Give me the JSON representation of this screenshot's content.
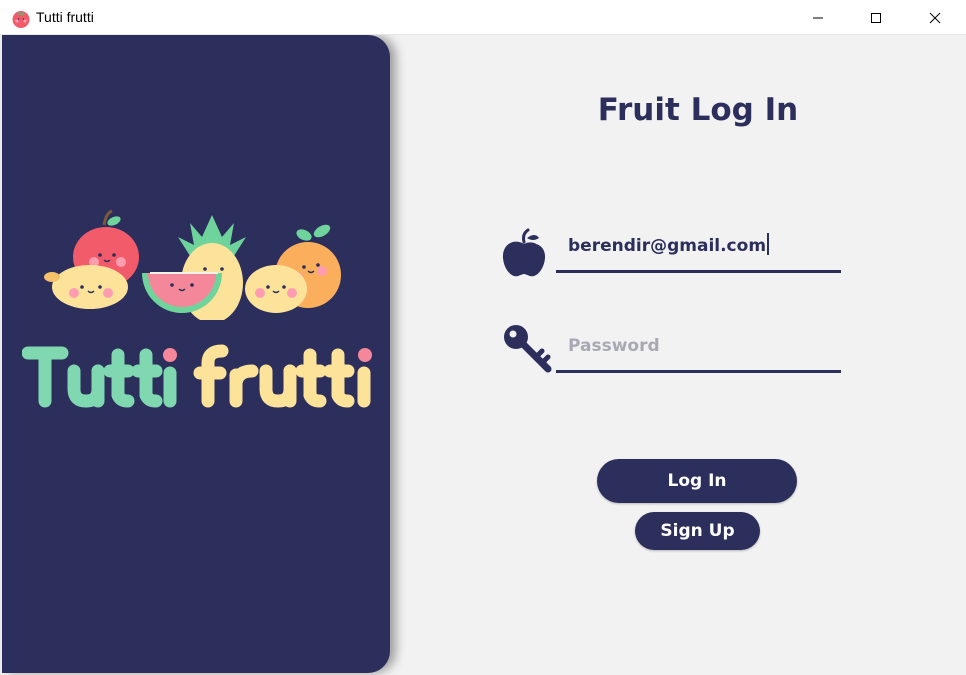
{
  "window": {
    "title": "Tutti frutti",
    "controls": [
      "minimize",
      "maximize",
      "close"
    ]
  },
  "brand": {
    "name": "Tutti frutti",
    "illustration": "smiling-fruits"
  },
  "form": {
    "title": "Fruit Log In",
    "email_value": "berendir@gmail.com",
    "password_placeholder": "Password",
    "login_label": "Log In",
    "signup_label": "Sign Up"
  },
  "icons": {
    "email": "apple-icon",
    "password": "key-icon"
  },
  "colors": {
    "primary": "#2c2e5c",
    "background": "#f2f2f2",
    "placeholder": "#a9a9b5",
    "mint": "#7fd8b0",
    "cream": "#fde39a",
    "pink": "#f4889a"
  }
}
